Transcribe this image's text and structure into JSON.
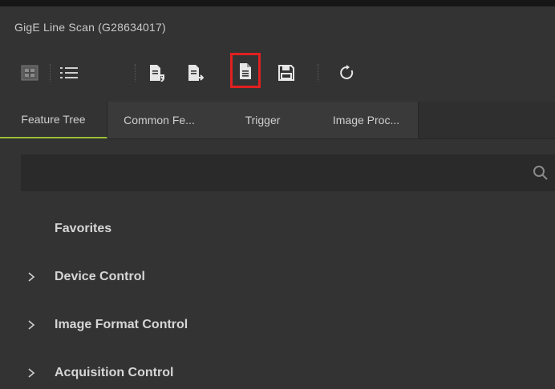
{
  "window": {
    "title": "GigE Line Scan (G28634017)"
  },
  "toolbar": {
    "buttons": [
      {
        "icon": "feature-tree-icon"
      },
      {
        "icon": "list-view-icon"
      },
      {
        "icon": "import-file-icon"
      },
      {
        "icon": "export-file-icon"
      },
      {
        "icon": "file-document-icon"
      },
      {
        "icon": "save-icon"
      },
      {
        "icon": "refresh-icon"
      }
    ],
    "active_button": "file-document-icon",
    "highlight_color": "#e02020"
  },
  "tabs": [
    {
      "label": "Feature Tree"
    },
    {
      "label": "Common Fe..."
    },
    {
      "label": "Trigger"
    },
    {
      "label": "Image Proc..."
    }
  ],
  "search": {
    "value": "",
    "placeholder": ""
  },
  "tree": {
    "items": [
      {
        "label": "Favorites",
        "expandable": false
      },
      {
        "label": "Device Control",
        "expandable": true
      },
      {
        "label": "Image Format Control",
        "expandable": true
      },
      {
        "label": "Acquisition Control",
        "expandable": true
      }
    ]
  },
  "colors": {
    "background": "#333333",
    "active_tab_underline": "#9fbf3a"
  }
}
